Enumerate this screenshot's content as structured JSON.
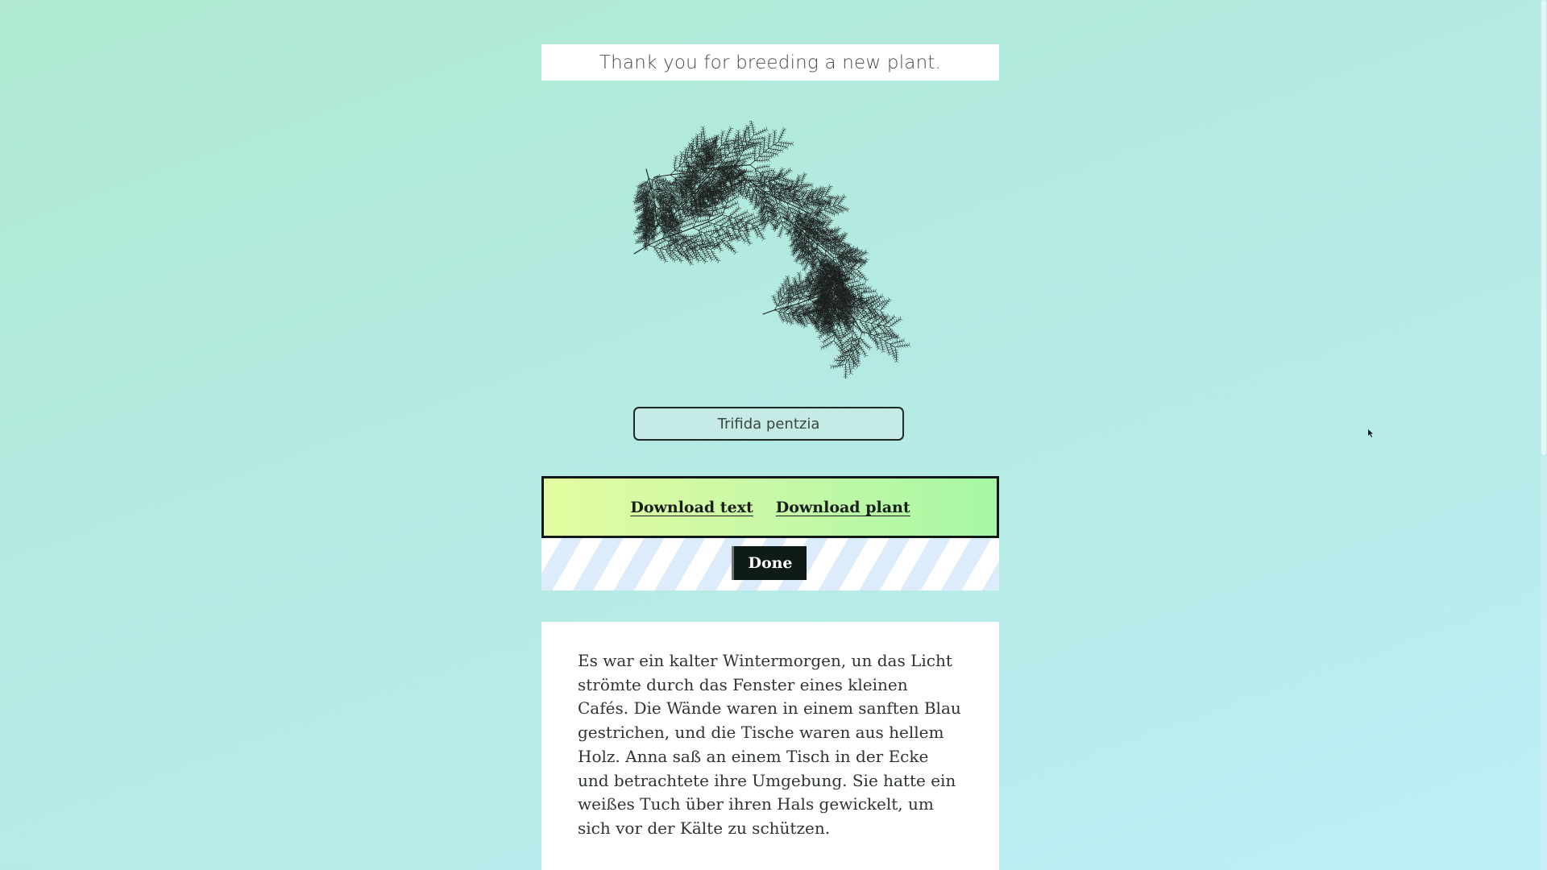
{
  "header": {
    "thank_you_message": "Thank you for breeding a new plant."
  },
  "plant": {
    "name": "Trifida pentzia",
    "icon": "plant-drawing"
  },
  "actions": {
    "download_text_label": "Download text",
    "download_plant_label": "Download plant",
    "done_label": "Done"
  },
  "story": {
    "paragraph": "Es war ein kalter Wintermorgen, un das Licht strömte durch das Fenster eines kleinen Cafés. Die Wände waren in einem sanften Blau gestrichen, und die Tische waren aus hellem Holz. Anna saß an einem Tisch in der Ecke und betrachtete ihre Umgebung. Sie hatte ein weißes Tuch über ihren Hals gewickelt, um sich vor der Kälte zu schützen."
  },
  "colors": {
    "background_start": "#aee9d0",
    "background_end": "#bdeef7",
    "download_bar_start": "#e4fca0",
    "download_bar_end": "#a6f7a4",
    "done_button": "#0f1b18"
  }
}
